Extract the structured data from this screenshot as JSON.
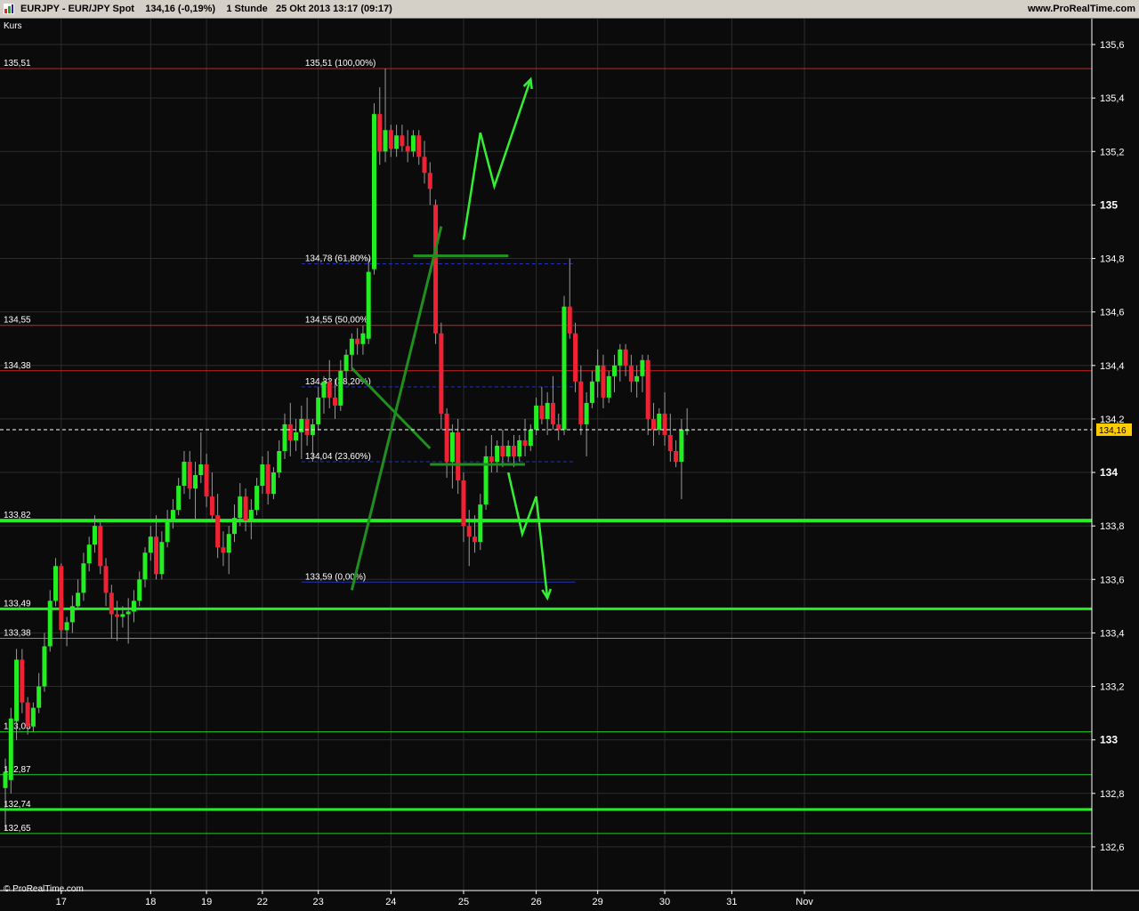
{
  "header": {
    "logo_icon": "prorealtime-logo-icon",
    "symbol": "EURJPY - EUR/JPY Spot",
    "quote": "134,16 (-0,19%)",
    "interval": "1 Stunde",
    "datetime": "25 Okt 2013 13:17 (09:17)",
    "brand": "www.ProRealTime.com"
  },
  "chart_data": {
    "type": "candlestick",
    "panel_label": "Kurs",
    "footer_credit": "© ProRealTime.com",
    "ylim": [
      132.5,
      135.65
    ],
    "y_ticks": [
      {
        "value": 135.6,
        "label": "135,6",
        "bold": false
      },
      {
        "value": 135.4,
        "label": "135,4",
        "bold": false
      },
      {
        "value": 135.2,
        "label": "135,2",
        "bold": false
      },
      {
        "value": 135.0,
        "label": "135",
        "bold": true
      },
      {
        "value": 134.8,
        "label": "134,8",
        "bold": false
      },
      {
        "value": 134.6,
        "label": "134,6",
        "bold": false
      },
      {
        "value": 134.4,
        "label": "134,4",
        "bold": false
      },
      {
        "value": 134.2,
        "label": "134,2",
        "bold": false
      },
      {
        "value": 134.0,
        "label": "134",
        "bold": true
      },
      {
        "value": 133.8,
        "label": "133,8",
        "bold": false
      },
      {
        "value": 133.6,
        "label": "133,6",
        "bold": false
      },
      {
        "value": 133.4,
        "label": "133,4",
        "bold": false
      },
      {
        "value": 133.2,
        "label": "133,2",
        "bold": false
      },
      {
        "value": 133.0,
        "label": "133",
        "bold": true
      },
      {
        "value": 132.8,
        "label": "132,8",
        "bold": false
      },
      {
        "value": 132.6,
        "label": "132,6",
        "bold": false
      }
    ],
    "x_ticks": [
      {
        "label": "17",
        "bar": 10
      },
      {
        "label": "18",
        "bar": 26
      },
      {
        "label": "19",
        "bar": 36
      },
      {
        "label": "22",
        "bar": 46
      },
      {
        "label": "23",
        "bar": 56
      },
      {
        "label": "24",
        "bar": 69
      },
      {
        "label": "25",
        "bar": 82
      },
      {
        "label": "26",
        "bar": 95
      },
      {
        "label": "29",
        "bar": 106
      },
      {
        "label": "30",
        "bar": 118
      },
      {
        "label": "31",
        "bar": 130
      },
      {
        "label": "Nov",
        "bar": 143
      }
    ],
    "last_price": {
      "value": 134.16,
      "label": "134,16",
      "color": "#ffcc00"
    },
    "horizontal_lines": [
      {
        "value": 135.51,
        "label": "135,51",
        "color": "#cc2222",
        "width": 1
      },
      {
        "value": 134.55,
        "label": "134,55",
        "color": "#cc2222",
        "width": 1
      },
      {
        "value": 134.38,
        "label": "134,38",
        "color": "#cc2222",
        "width": 1
      },
      {
        "value": 133.82,
        "label": "133,82",
        "color": "#22ee22",
        "width": 4
      },
      {
        "value": 133.49,
        "label": "133,49",
        "color": "#22ee22",
        "width": 3
      },
      {
        "value": 133.38,
        "label": "133,38",
        "color": "#22cc22",
        "width": 1
      },
      {
        "value": 133.03,
        "label": "133,03",
        "color": "#22cc22",
        "width": 1
      },
      {
        "value": 132.87,
        "label": "132,87",
        "color": "#22cc22",
        "width": 1
      },
      {
        "value": 132.74,
        "label": "132,74",
        "color": "#22ee22",
        "width": 3
      },
      {
        "value": 132.65,
        "label": "132,65",
        "color": "#22cc22",
        "width": 1
      }
    ],
    "fibonacci": {
      "start_bar": 53,
      "end_bar": 102,
      "levels": [
        {
          "value": 135.51,
          "label": "135,51 (100,00%)",
          "style": "none"
        },
        {
          "value": 134.78,
          "label": "134,78 (61,80%)",
          "style": "dashed"
        },
        {
          "value": 134.55,
          "label": "134,55 (50,00%)",
          "style": "none"
        },
        {
          "value": 134.32,
          "label": "134,32 (38,20%)",
          "style": "dashed"
        },
        {
          "value": 134.04,
          "label": "134,04 (23,60%)",
          "style": "dashed"
        },
        {
          "value": 133.59,
          "label": "133,59 (0,00%)",
          "style": "solid"
        }
      ],
      "color": "#2233bb"
    },
    "trend_lines": [
      {
        "bar1": 62,
        "v1": 133.56,
        "bar2": 78,
        "v2": 134.92,
        "color": "#1f8f1f"
      },
      {
        "bar1": 62,
        "v1": 134.39,
        "bar2": 76,
        "v2": 134.09,
        "color": "#1f8f1f"
      },
      {
        "bar1": 73,
        "v1": 134.81,
        "bar2": 90,
        "v2": 134.81,
        "color": "#1f8f1f"
      },
      {
        "bar1": 76,
        "v1": 134.03,
        "bar2": 93,
        "v2": 134.03,
        "color": "#1f8f1f"
      }
    ],
    "arrows": [
      {
        "points": [
          [
            82,
            134.87
          ],
          [
            85,
            135.27
          ],
          [
            87.5,
            135.07
          ],
          [
            94,
            135.47
          ]
        ],
        "color": "#33ee33"
      },
      {
        "points": [
          [
            90,
            134.0
          ],
          [
            92.5,
            133.77
          ],
          [
            95,
            133.91
          ],
          [
            97,
            133.53
          ]
        ],
        "color": "#33ee33"
      }
    ],
    "up_color": "#22ee22",
    "down_color": "#ee2233",
    "candles": [
      {
        "o": 132.82,
        "h": 132.93,
        "l": 132.66,
        "c": 132.88
      },
      {
        "o": 132.85,
        "h": 133.12,
        "l": 132.8,
        "c": 133.08
      },
      {
        "o": 133.07,
        "h": 133.34,
        "l": 133.0,
        "c": 133.3
      },
      {
        "o": 133.3,
        "h": 133.34,
        "l": 133.1,
        "c": 133.14
      },
      {
        "o": 133.14,
        "h": 133.16,
        "l": 133.02,
        "c": 133.05
      },
      {
        "o": 133.05,
        "h": 133.14,
        "l": 133.03,
        "c": 133.12
      },
      {
        "o": 133.12,
        "h": 133.25,
        "l": 133.1,
        "c": 133.2
      },
      {
        "o": 133.2,
        "h": 133.4,
        "l": 133.18,
        "c": 133.35
      },
      {
        "o": 133.35,
        "h": 133.56,
        "l": 133.33,
        "c": 133.52
      },
      {
        "o": 133.52,
        "h": 133.68,
        "l": 133.5,
        "c": 133.65
      },
      {
        "o": 133.65,
        "h": 133.66,
        "l": 133.38,
        "c": 133.41
      },
      {
        "o": 133.41,
        "h": 133.46,
        "l": 133.35,
        "c": 133.44
      },
      {
        "o": 133.44,
        "h": 133.54,
        "l": 133.4,
        "c": 133.5
      },
      {
        "o": 133.5,
        "h": 133.6,
        "l": 133.49,
        "c": 133.55
      },
      {
        "o": 133.55,
        "h": 133.7,
        "l": 133.52,
        "c": 133.66
      },
      {
        "o": 133.66,
        "h": 133.76,
        "l": 133.63,
        "c": 133.73
      },
      {
        "o": 133.73,
        "h": 133.84,
        "l": 133.7,
        "c": 133.8
      },
      {
        "o": 133.8,
        "h": 133.82,
        "l": 133.62,
        "c": 133.65
      },
      {
        "o": 133.65,
        "h": 133.68,
        "l": 133.5,
        "c": 133.55
      },
      {
        "o": 133.55,
        "h": 133.58,
        "l": 133.38,
        "c": 133.47
      },
      {
        "o": 133.47,
        "h": 133.52,
        "l": 133.37,
        "c": 133.46
      },
      {
        "o": 133.46,
        "h": 133.5,
        "l": 133.42,
        "c": 133.47
      },
      {
        "o": 133.47,
        "h": 133.53,
        "l": 133.36,
        "c": 133.48
      },
      {
        "o": 133.48,
        "h": 133.56,
        "l": 133.44,
        "c": 133.52
      },
      {
        "o": 133.52,
        "h": 133.63,
        "l": 133.5,
        "c": 133.6
      },
      {
        "o": 133.6,
        "h": 133.72,
        "l": 133.57,
        "c": 133.7
      },
      {
        "o": 133.7,
        "h": 133.8,
        "l": 133.67,
        "c": 133.76
      },
      {
        "o": 133.76,
        "h": 133.84,
        "l": 133.6,
        "c": 133.62
      },
      {
        "o": 133.62,
        "h": 133.78,
        "l": 133.6,
        "c": 133.74
      },
      {
        "o": 133.74,
        "h": 133.86,
        "l": 133.72,
        "c": 133.82
      },
      {
        "o": 133.82,
        "h": 133.9,
        "l": 133.79,
        "c": 133.86
      },
      {
        "o": 133.86,
        "h": 133.98,
        "l": 133.84,
        "c": 133.95
      },
      {
        "o": 133.95,
        "h": 134.08,
        "l": 133.92,
        "c": 134.04
      },
      {
        "o": 134.04,
        "h": 134.08,
        "l": 133.9,
        "c": 133.94
      },
      {
        "o": 133.94,
        "h": 134.04,
        "l": 133.82,
        "c": 133.99
      },
      {
        "o": 133.99,
        "h": 134.15,
        "l": 133.96,
        "c": 134.03
      },
      {
        "o": 134.03,
        "h": 134.07,
        "l": 133.87,
        "c": 133.91
      },
      {
        "o": 133.91,
        "h": 134.0,
        "l": 133.82,
        "c": 133.84
      },
      {
        "o": 133.84,
        "h": 133.92,
        "l": 133.68,
        "c": 133.72
      },
      {
        "o": 133.72,
        "h": 133.78,
        "l": 133.65,
        "c": 133.7
      },
      {
        "o": 133.7,
        "h": 133.8,
        "l": 133.62,
        "c": 133.77
      },
      {
        "o": 133.77,
        "h": 133.88,
        "l": 133.74,
        "c": 133.83
      },
      {
        "o": 133.83,
        "h": 133.96,
        "l": 133.8,
        "c": 133.91
      },
      {
        "o": 133.91,
        "h": 133.94,
        "l": 133.78,
        "c": 133.82
      },
      {
        "o": 133.82,
        "h": 133.9,
        "l": 133.75,
        "c": 133.86
      },
      {
        "o": 133.86,
        "h": 133.98,
        "l": 133.84,
        "c": 133.95
      },
      {
        "o": 133.95,
        "h": 134.06,
        "l": 133.92,
        "c": 134.03
      },
      {
        "o": 134.03,
        "h": 134.08,
        "l": 133.88,
        "c": 133.92
      },
      {
        "o": 133.92,
        "h": 134.02,
        "l": 133.9,
        "c": 134.0
      },
      {
        "o": 134.0,
        "h": 134.12,
        "l": 133.98,
        "c": 134.08
      },
      {
        "o": 134.08,
        "h": 134.22,
        "l": 134.05,
        "c": 134.18
      },
      {
        "o": 134.18,
        "h": 134.26,
        "l": 134.06,
        "c": 134.12
      },
      {
        "o": 134.12,
        "h": 134.2,
        "l": 134.08,
        "c": 134.15
      },
      {
        "o": 134.15,
        "h": 134.25,
        "l": 134.05,
        "c": 134.2
      },
      {
        "o": 134.2,
        "h": 134.28,
        "l": 134.1,
        "c": 134.14
      },
      {
        "o": 134.14,
        "h": 134.2,
        "l": 134.04,
        "c": 134.18
      },
      {
        "o": 134.18,
        "h": 134.32,
        "l": 134.16,
        "c": 134.28
      },
      {
        "o": 134.28,
        "h": 134.36,
        "l": 134.22,
        "c": 134.34
      },
      {
        "o": 134.34,
        "h": 134.42,
        "l": 134.24,
        "c": 134.28
      },
      {
        "o": 134.28,
        "h": 134.35,
        "l": 134.2,
        "c": 134.25
      },
      {
        "o": 134.25,
        "h": 134.42,
        "l": 134.23,
        "c": 134.38
      },
      {
        "o": 134.38,
        "h": 134.46,
        "l": 134.33,
        "c": 134.44
      },
      {
        "o": 134.44,
        "h": 134.52,
        "l": 134.38,
        "c": 134.5
      },
      {
        "o": 134.5,
        "h": 134.54,
        "l": 134.44,
        "c": 134.48
      },
      {
        "o": 134.48,
        "h": 134.55,
        "l": 134.44,
        "c": 134.52
      },
      {
        "o": 134.5,
        "h": 134.8,
        "l": 134.48,
        "c": 134.75
      },
      {
        "o": 134.76,
        "h": 135.38,
        "l": 134.74,
        "c": 135.34
      },
      {
        "o": 135.34,
        "h": 135.44,
        "l": 135.15,
        "c": 135.2
      },
      {
        "o": 135.2,
        "h": 135.51,
        "l": 135.16,
        "c": 135.28
      },
      {
        "o": 135.28,
        "h": 135.3,
        "l": 135.18,
        "c": 135.21
      },
      {
        "o": 135.21,
        "h": 135.3,
        "l": 135.18,
        "c": 135.26
      },
      {
        "o": 135.26,
        "h": 135.3,
        "l": 135.2,
        "c": 135.22
      },
      {
        "o": 135.22,
        "h": 135.28,
        "l": 135.16,
        "c": 135.2
      },
      {
        "o": 135.2,
        "h": 135.28,
        "l": 135.18,
        "c": 135.26
      },
      {
        "o": 135.26,
        "h": 135.28,
        "l": 135.15,
        "c": 135.18
      },
      {
        "o": 135.18,
        "h": 135.24,
        "l": 135.08,
        "c": 135.12
      },
      {
        "o": 135.12,
        "h": 135.16,
        "l": 135.0,
        "c": 135.06
      },
      {
        "o": 135.0,
        "h": 135.02,
        "l": 134.48,
        "c": 134.52
      },
      {
        "o": 134.52,
        "h": 134.56,
        "l": 134.16,
        "c": 134.22
      },
      {
        "o": 134.22,
        "h": 134.24,
        "l": 133.98,
        "c": 134.04
      },
      {
        "o": 134.04,
        "h": 134.18,
        "l": 133.94,
        "c": 134.15
      },
      {
        "o": 134.15,
        "h": 134.2,
        "l": 133.92,
        "c": 133.97
      },
      {
        "o": 133.97,
        "h": 134.0,
        "l": 133.74,
        "c": 133.8
      },
      {
        "o": 133.8,
        "h": 133.86,
        "l": 133.65,
        "c": 133.76
      },
      {
        "o": 133.76,
        "h": 133.84,
        "l": 133.7,
        "c": 133.74
      },
      {
        "o": 133.74,
        "h": 133.92,
        "l": 133.71,
        "c": 133.88
      },
      {
        "o": 133.88,
        "h": 134.1,
        "l": 133.86,
        "c": 134.06
      },
      {
        "o": 134.06,
        "h": 134.14,
        "l": 134.0,
        "c": 134.04
      },
      {
        "o": 134.04,
        "h": 134.12,
        "l": 134.0,
        "c": 134.1
      },
      {
        "o": 134.1,
        "h": 134.16,
        "l": 134.02,
        "c": 134.06
      },
      {
        "o": 134.06,
        "h": 134.12,
        "l": 134.04,
        "c": 134.1
      },
      {
        "o": 134.1,
        "h": 134.14,
        "l": 134.02,
        "c": 134.06
      },
      {
        "o": 134.06,
        "h": 134.14,
        "l": 134.04,
        "c": 134.12
      },
      {
        "o": 134.12,
        "h": 134.2,
        "l": 134.06,
        "c": 134.1
      },
      {
        "o": 134.1,
        "h": 134.18,
        "l": 134.08,
        "c": 134.16
      },
      {
        "o": 134.16,
        "h": 134.28,
        "l": 134.14,
        "c": 134.25
      },
      {
        "o": 134.25,
        "h": 134.32,
        "l": 134.18,
        "c": 134.2
      },
      {
        "o": 134.2,
        "h": 134.3,
        "l": 134.14,
        "c": 134.26
      },
      {
        "o": 134.26,
        "h": 134.36,
        "l": 134.16,
        "c": 134.18
      },
      {
        "o": 134.18,
        "h": 134.22,
        "l": 134.12,
        "c": 134.16
      },
      {
        "o": 134.16,
        "h": 134.66,
        "l": 134.14,
        "c": 134.62
      },
      {
        "o": 134.62,
        "h": 134.8,
        "l": 134.5,
        "c": 134.52
      },
      {
        "o": 134.52,
        "h": 134.56,
        "l": 134.3,
        "c": 134.34
      },
      {
        "o": 134.34,
        "h": 134.4,
        "l": 134.14,
        "c": 134.18
      },
      {
        "o": 134.18,
        "h": 134.3,
        "l": 134.06,
        "c": 134.26
      },
      {
        "o": 134.26,
        "h": 134.38,
        "l": 134.24,
        "c": 134.34
      },
      {
        "o": 134.34,
        "h": 134.46,
        "l": 134.28,
        "c": 134.4
      },
      {
        "o": 134.4,
        "h": 134.44,
        "l": 134.24,
        "c": 134.28
      },
      {
        "o": 134.28,
        "h": 134.38,
        "l": 134.26,
        "c": 134.36
      },
      {
        "o": 134.36,
        "h": 134.44,
        "l": 134.3,
        "c": 134.4
      },
      {
        "o": 134.4,
        "h": 134.48,
        "l": 134.34,
        "c": 134.46
      },
      {
        "o": 134.46,
        "h": 134.48,
        "l": 134.36,
        "c": 134.4
      },
      {
        "o": 134.4,
        "h": 134.44,
        "l": 134.3,
        "c": 134.34
      },
      {
        "o": 134.34,
        "h": 134.4,
        "l": 134.28,
        "c": 134.36
      },
      {
        "o": 134.36,
        "h": 134.44,
        "l": 134.3,
        "c": 134.42
      },
      {
        "o": 134.42,
        "h": 134.44,
        "l": 134.14,
        "c": 134.2
      },
      {
        "o": 134.2,
        "h": 134.26,
        "l": 134.1,
        "c": 134.16
      },
      {
        "o": 134.16,
        "h": 134.24,
        "l": 134.14,
        "c": 134.22
      },
      {
        "o": 134.22,
        "h": 134.3,
        "l": 134.1,
        "c": 134.14
      },
      {
        "o": 134.14,
        "h": 134.22,
        "l": 134.04,
        "c": 134.08
      },
      {
        "o": 134.08,
        "h": 134.12,
        "l": 134.02,
        "c": 134.04
      },
      {
        "o": 134.04,
        "h": 134.2,
        "l": 133.9,
        "c": 134.16
      },
      {
        "o": 134.16,
        "h": 134.24,
        "l": 134.14,
        "c": 134.16
      }
    ]
  }
}
